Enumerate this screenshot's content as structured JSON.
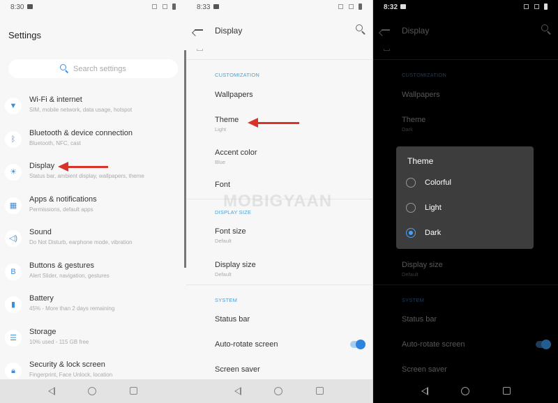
{
  "colors": {
    "accent": "#3e8ed9",
    "section_header_light": "#4a9fd4",
    "annotation_arrow": "#d8322b",
    "dialog_bg": "#3d3d3d",
    "radio_selected": "#4b9ff2"
  },
  "panel_settings": {
    "status": {
      "time": "8:30"
    },
    "title": "Settings",
    "search": {
      "placeholder": "Search settings",
      "icon": "search-icon"
    },
    "items": [
      {
        "label": "Wi-Fi & internet",
        "subtitle": "SIM, mobile network, data usage, hotspot",
        "icon": "wifi-icon"
      },
      {
        "label": "Bluetooth & device connection",
        "subtitle": "Bluetooth, NFC, cast",
        "icon": "bluetooth-icon"
      },
      {
        "label": "Display",
        "subtitle": "Status bar, ambient display, wallpapers, theme",
        "icon": "brightness-icon"
      },
      {
        "label": "Apps & notifications",
        "subtitle": "Permissions, default apps",
        "icon": "apps-grid-icon"
      },
      {
        "label": "Sound",
        "subtitle": "Do Not Disturb, earphone mode, vibration",
        "icon": "speaker-icon"
      },
      {
        "label": "Buttons & gestures",
        "subtitle": "Alert Slider, navigation, gestures",
        "icon": "button-icon"
      },
      {
        "label": "Battery",
        "subtitle": "45% - More than 2 days remaining",
        "icon": "battery-icon"
      },
      {
        "label": "Storage",
        "subtitle": "10% used - 115 GB free",
        "icon": "storage-icon"
      },
      {
        "label": "Security & lock screen",
        "subtitle": "Fingerprint, Face Unlock, location",
        "icon": "lock-icon"
      }
    ]
  },
  "panel_display_light": {
    "status": {
      "time": "8:33"
    },
    "title": "Display",
    "sections": {
      "customization": "CUSTOMIZATION",
      "display_size": "DISPLAY SIZE",
      "system": "SYSTEM"
    },
    "rows": {
      "wallpapers": {
        "label": "Wallpapers"
      },
      "theme": {
        "label": "Theme",
        "value": "Light"
      },
      "accent_color": {
        "label": "Accent color",
        "value": "Blue"
      },
      "font": {
        "label": "Font"
      },
      "font_size": {
        "label": "Font size",
        "value": "Default"
      },
      "display_size": {
        "label": "Display size",
        "value": "Default"
      },
      "status_bar": {
        "label": "Status bar"
      },
      "auto_rotate": {
        "label": "Auto-rotate screen",
        "enabled": true
      },
      "screen_saver": {
        "label": "Screen saver"
      }
    }
  },
  "panel_display_dark": {
    "status": {
      "time": "8:32"
    },
    "title": "Display",
    "sections": {
      "customization": "CUSTOMIZATION",
      "system": "SYSTEM"
    },
    "rows": {
      "wallpapers": {
        "label": "Wallpapers"
      },
      "theme": {
        "label": "Theme",
        "value": "Dark"
      },
      "display_size": {
        "label": "Display size",
        "value": "Default"
      },
      "status_bar": {
        "label": "Status bar"
      },
      "auto_rotate": {
        "label": "Auto-rotate screen",
        "enabled": true
      },
      "screen_saver": {
        "label": "Screen saver"
      }
    },
    "theme_dialog": {
      "title": "Theme",
      "options": [
        {
          "label": "Colorful",
          "selected": false
        },
        {
          "label": "Light",
          "selected": false
        },
        {
          "label": "Dark",
          "selected": true
        }
      ]
    }
  },
  "watermark": "MOBIGYAAN"
}
